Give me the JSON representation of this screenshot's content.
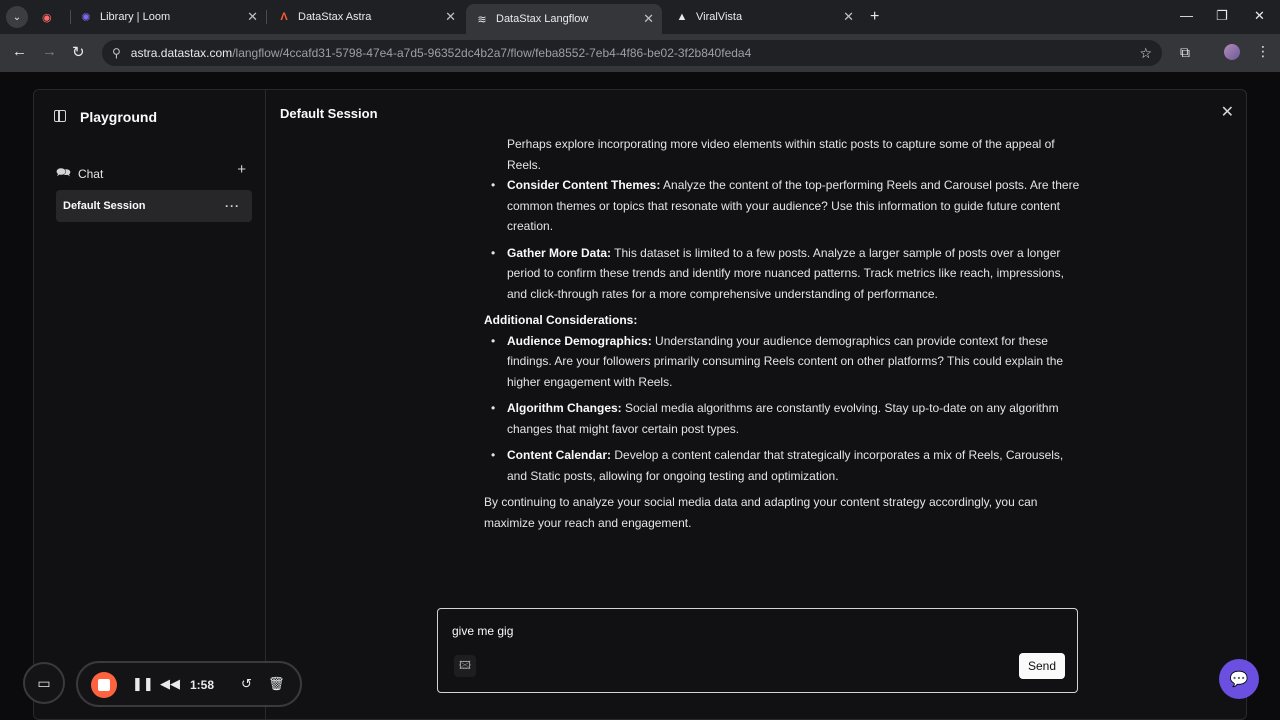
{
  "browser": {
    "tabs": [
      {
        "label": "",
        "icon": "loom-record-icon"
      },
      {
        "label": "Library | Loom",
        "icon": "loom-icon"
      },
      {
        "label": "DataStax Astra",
        "icon": "astra-icon"
      },
      {
        "label": "DataStax Langflow",
        "icon": "langflow-icon",
        "active": true
      },
      {
        "label": "ViralVista",
        "icon": "triangle-icon"
      }
    ],
    "url_host": "astra.datastax.com",
    "url_path": "/langflow/4ccafd31-5798-47e4-a7d5-96352dc4b2a7/flow/feba8552-7eb4-4f86-be02-3f2b840feda4"
  },
  "sidebar": {
    "title": "Playground",
    "chat_label": "Chat",
    "session_label": "Default Session",
    "more_label": "···"
  },
  "main": {
    "session_title": "Default Session",
    "message": {
      "intro_fragment": "Perhaps explore incorporating more video elements within static posts to capture some of the appeal of Reels.",
      "bullets_1": [
        {
          "title": "Consider Content Themes:",
          "text": " Analyze the content of the top-performing Reels and Carousel posts. Are there common themes or topics that resonate with your audience? Use this information to guide future content creation."
        },
        {
          "title": "Gather More Data:",
          "text": " This dataset is limited to a few posts. Analyze a larger sample of posts over a longer period to confirm these trends and identify more nuanced patterns. Track metrics like reach, impressions, and click-through rates for a more comprehensive understanding of performance."
        }
      ],
      "heading": "Additional Considerations:",
      "bullets_2": [
        {
          "title": "Audience Demographics:",
          "text": " Understanding your audience demographics can provide context for these findings. Are your followers primarily consuming Reels content on other platforms? This could explain the higher engagement with Reels."
        },
        {
          "title": "Algorithm Changes:",
          "text": " Social media algorithms are constantly evolving. Stay up-to-date on any algorithm changes that might favor certain post types."
        },
        {
          "title": "Content Calendar:",
          "text": " Develop a content calendar that strategically incorporates a mix of Reels, Carousels, and Static posts, allowing for ongoing testing and optimization."
        }
      ],
      "closing": "By continuing to analyze your social media data and adapting your content strategy accordingly, you can maximize your reach and engagement."
    },
    "input_value": "give me gig",
    "send_label": "Send"
  },
  "loom": {
    "time": "1:58"
  }
}
